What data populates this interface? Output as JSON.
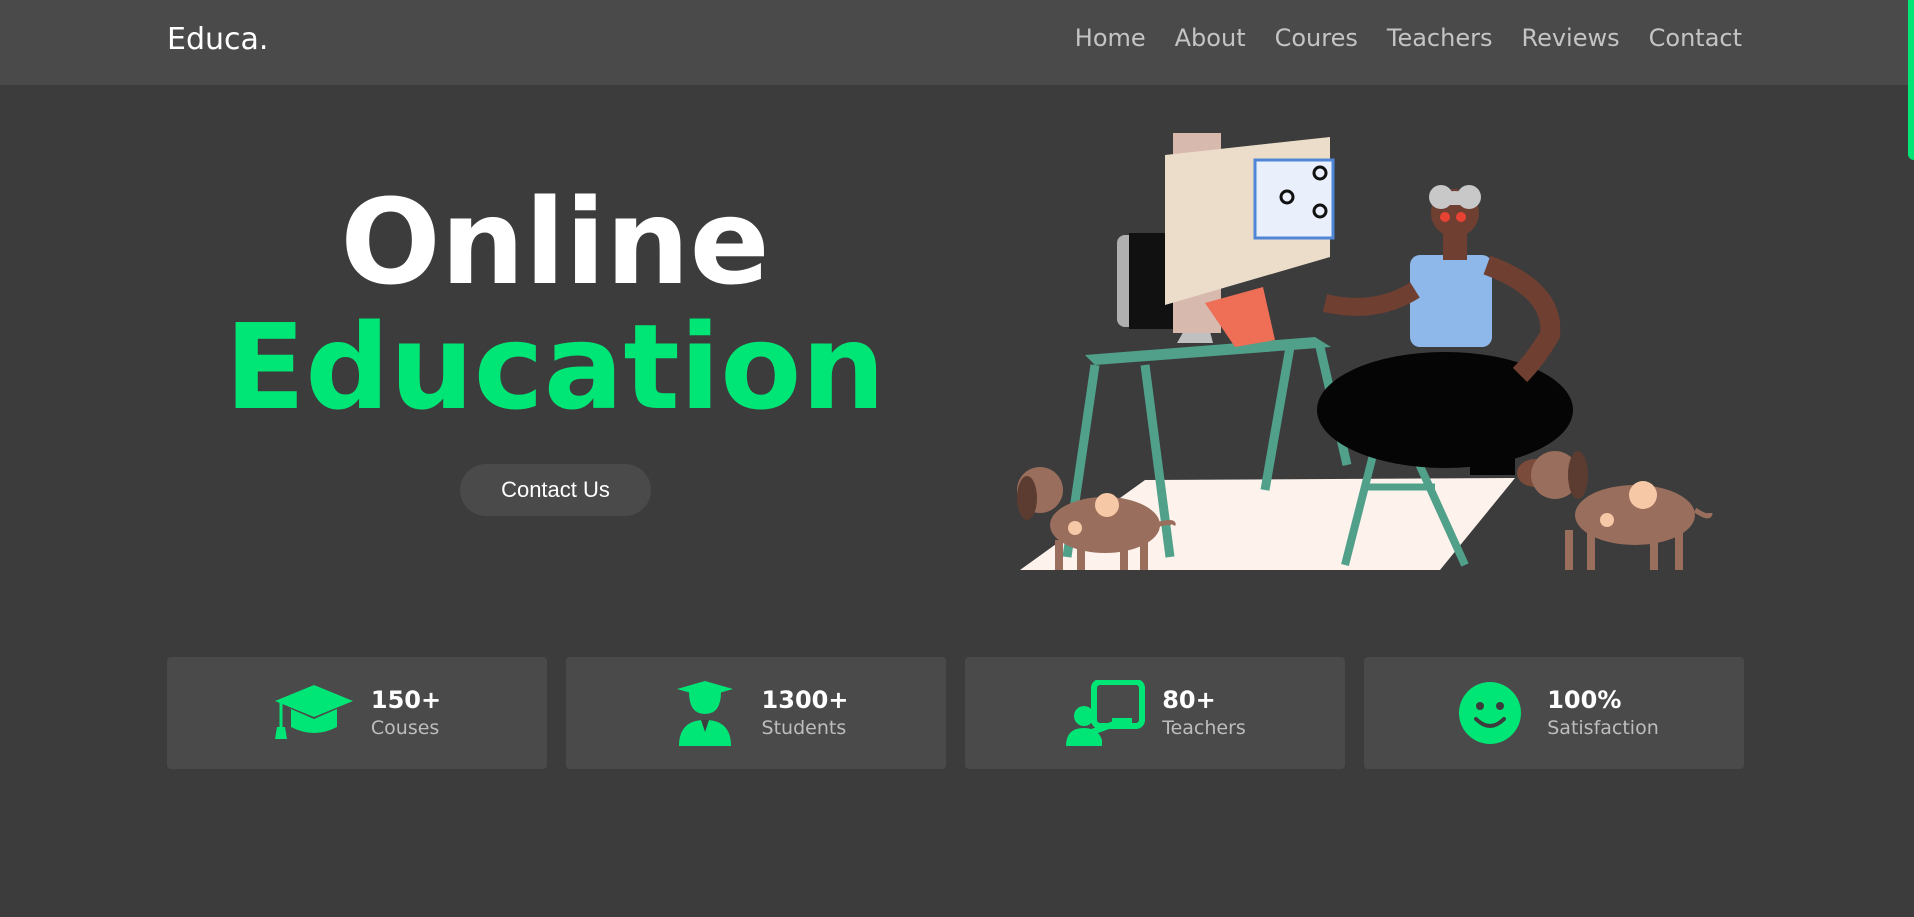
{
  "header": {
    "logo": "Educa.",
    "nav": [
      "Home",
      "About",
      "Coures",
      "Teachers",
      "Reviews",
      "Contact"
    ]
  },
  "hero": {
    "title_line1": "Online",
    "title_line2": "Education",
    "cta_label": "Contact Us",
    "illustration": "woman-at-computer-with-dogs-illustration"
  },
  "stats": [
    {
      "icon": "graduation-cap-icon",
      "value": "150+",
      "label": "Couses"
    },
    {
      "icon": "graduate-student-icon",
      "value": "1300+",
      "label": "Students"
    },
    {
      "icon": "teacher-board-icon",
      "value": "80+",
      "label": "Teachers"
    },
    {
      "icon": "smile-icon",
      "value": "100%",
      "label": "Satisfaction"
    }
  ],
  "colors": {
    "accent": "#00e676",
    "background": "#3c3c3c",
    "header_bg": "#4a4a4a",
    "card_bg": "#4a4a4a"
  }
}
